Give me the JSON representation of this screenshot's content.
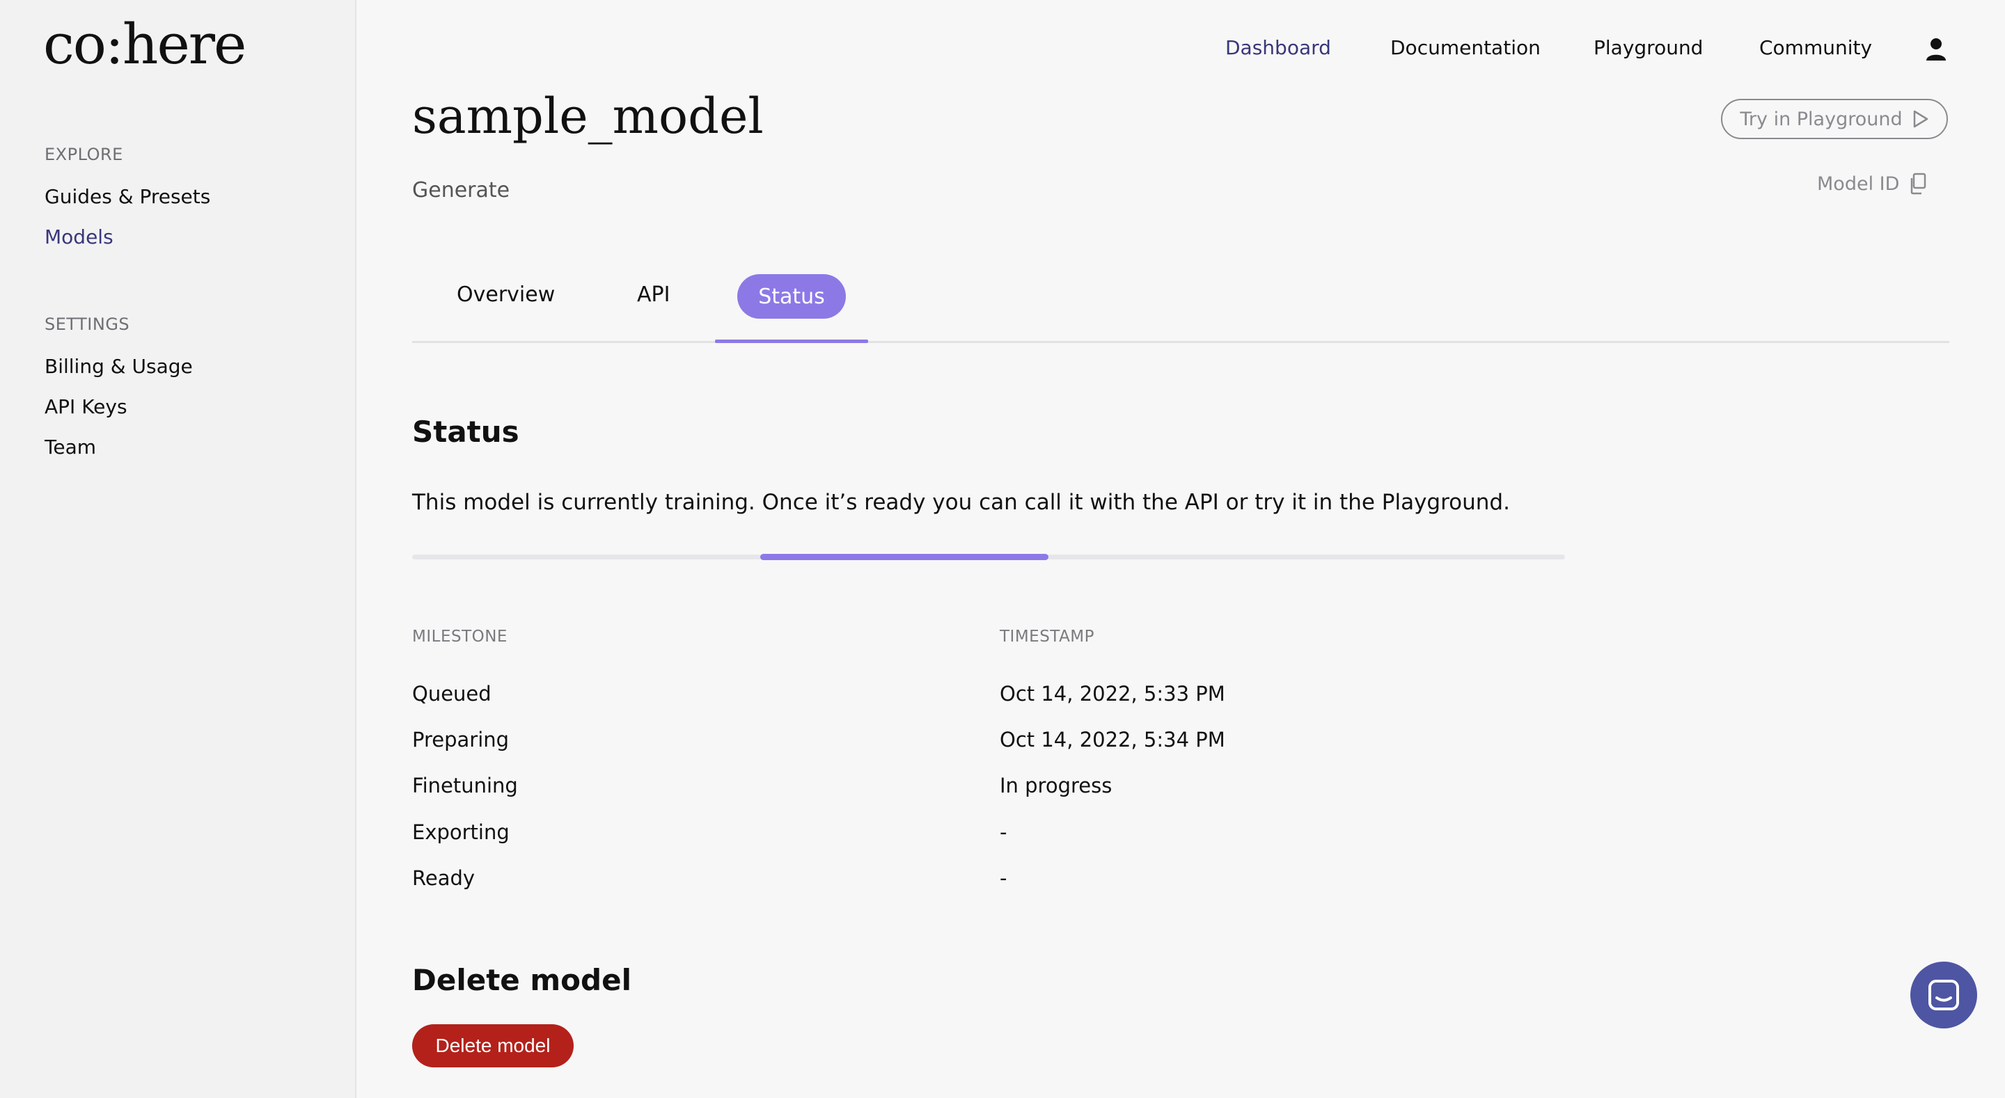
{
  "sidebar": {
    "logo": "co:here",
    "explore_label": "EXPLORE",
    "explore_items": [
      "Guides & Presets",
      "Models"
    ],
    "settings_label": "SETTINGS",
    "settings_items": [
      "Billing & Usage",
      "API Keys",
      "Team"
    ]
  },
  "topnav": {
    "items": [
      "Dashboard",
      "Documentation",
      "Playground",
      "Community"
    ],
    "active": "Dashboard",
    "user_icon": "user-icon"
  },
  "header": {
    "title": "sample_model",
    "subtitle": "Generate",
    "try_button": "Try in Playground",
    "model_id_label": "Model ID"
  },
  "tabs": [
    "Overview",
    "API",
    "Status"
  ],
  "active_tab": "Status",
  "status": {
    "heading": "Status",
    "description": "This model is currently training. Once it’s ready you can call it with the API or try it in the Playground.",
    "progress_indicator_start": 0.302,
    "progress_indicator_end": 0.552,
    "columns": [
      "MILESTONE",
      "TIMESTAMP"
    ],
    "rows": [
      {
        "milestone": "Queued",
        "timestamp": "Oct 14, 2022, 5:33 PM"
      },
      {
        "milestone": "Preparing",
        "timestamp": "Oct 14, 2022, 5:34 PM"
      },
      {
        "milestone": "Finetuning",
        "timestamp": "In progress"
      },
      {
        "milestone": "Exporting",
        "timestamp": "-"
      },
      {
        "milestone": "Ready",
        "timestamp": "-"
      }
    ]
  },
  "delete": {
    "heading": "Delete model",
    "button": "Delete model"
  },
  "colors": {
    "accent": "#8c79e6",
    "nav_active": "#39377a",
    "danger": "#b3211a",
    "chat": "#4e55a3"
  }
}
